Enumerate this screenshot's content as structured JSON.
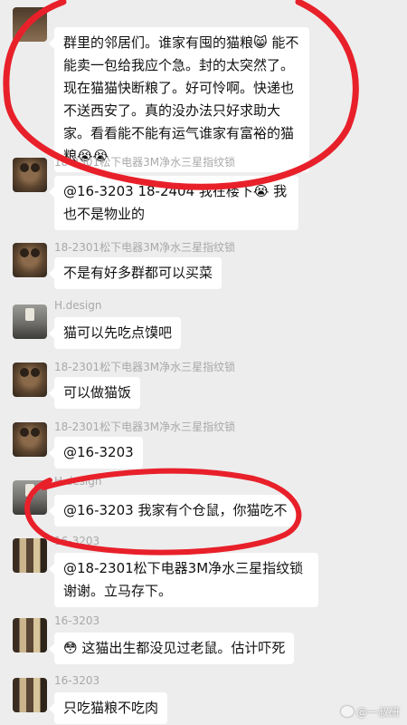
{
  "messages": [
    {
      "name": "",
      "text": "群里的邻居们。谁家有囤的猫粮😸 能不能卖一包给我应个急。封的太突然了。现在猫猫快断粮了。好可怜啊。快递也不送西安了。真的没办法只好求助大家。看看能不能有运气谁家有富裕的猫粮😭😭"
    },
    {
      "name": "18-2301松下电器3M净水三星指纹锁",
      "text": "@16-3203 18-2404 我在楼下😭 我也不是物业的"
    },
    {
      "name": "18-2301松下电器3M净水三星指纹锁",
      "text": "不是有好多群都可以买菜"
    },
    {
      "name": "H.design",
      "text": "猫可以先吃点馍吧"
    },
    {
      "name": "18-2301松下电器3M净水三星指纹锁",
      "text": "可以做猫饭"
    },
    {
      "name": "18-2301松下电器3M净水三星指纹锁",
      "text": "@16-3203"
    },
    {
      "name": "H.design",
      "text": "@16-3203 我家有个仓鼠，你猫吃不"
    },
    {
      "name": "16-3203",
      "text": "@18-2301松下电器3M净水三星指纹锁 谢谢。立马存下。"
    },
    {
      "name": "16-3203",
      "text": "😳 这猫出生都没见过老鼠。估计吓死"
    },
    {
      "name": "16-3203",
      "text": "只吃猫粮不吃肉"
    }
  ],
  "watermark": "@一叔研",
  "colors": {
    "annotation": "#e8202a",
    "bubble": "#ffffff",
    "background": "#ededed"
  }
}
